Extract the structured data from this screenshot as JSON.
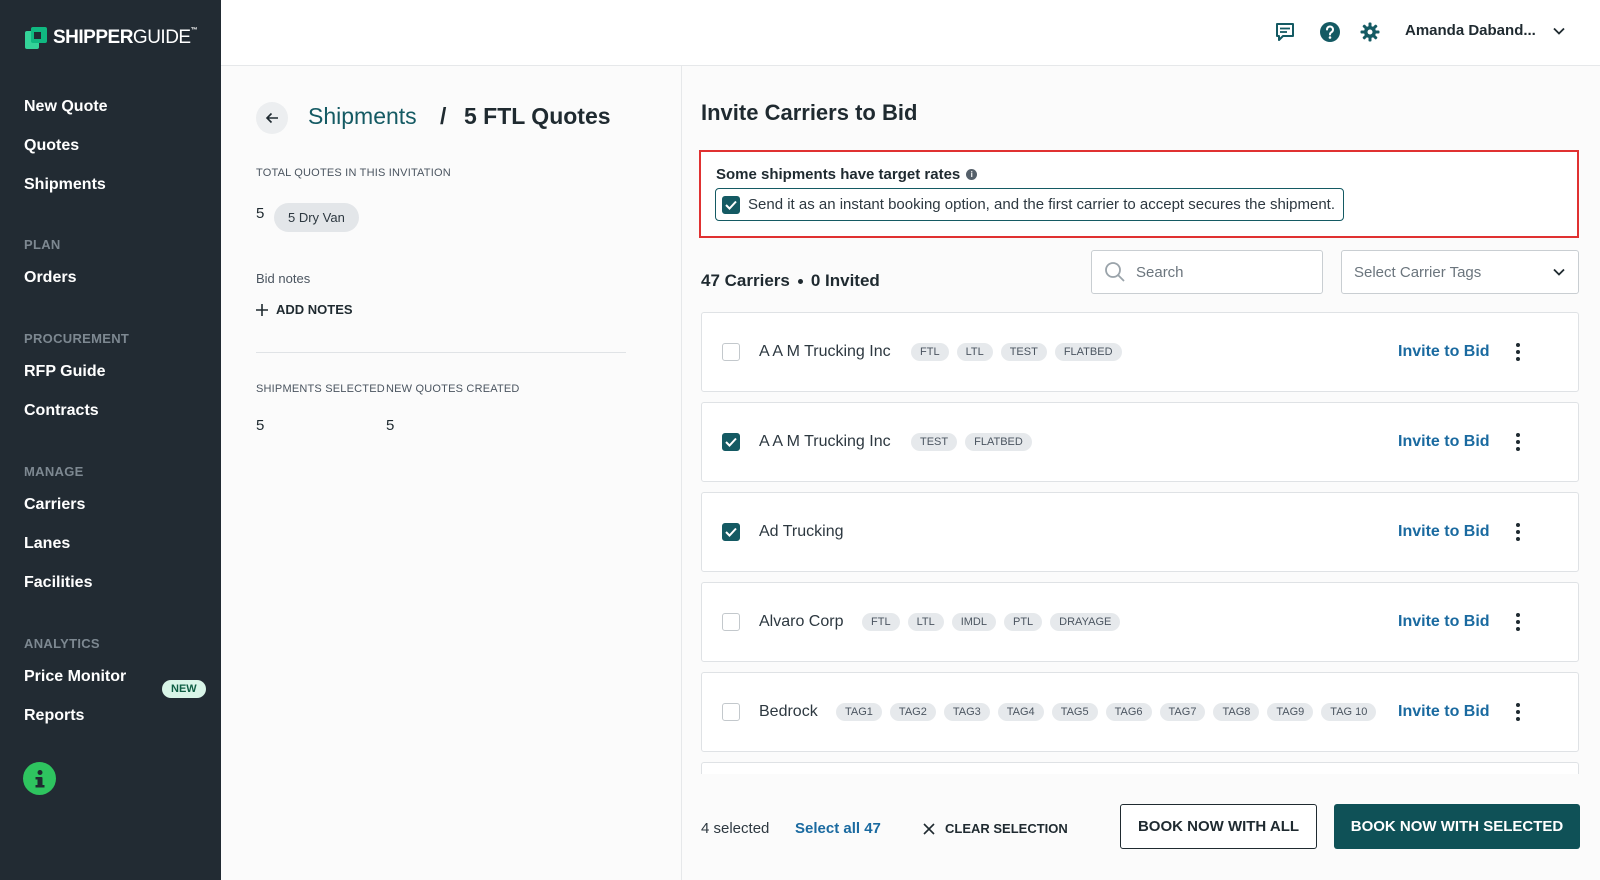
{
  "app": {
    "logo_bold": "SHIPPER",
    "logo_light": "GUIDE",
    "logo_tm": "™"
  },
  "sidebar": {
    "items_top": [
      {
        "label": "New Quote"
      },
      {
        "label": "Quotes"
      },
      {
        "label": "Shipments"
      }
    ],
    "section_plan": "PLAN",
    "orders": "Orders",
    "section_procurement": "PROCUREMENT",
    "rfp_guide": "RFP Guide",
    "contracts": "Contracts",
    "section_manage": "MANAGE",
    "carriers": "Carriers",
    "lanes": "Lanes",
    "facilities": "Facilities",
    "section_analytics": "ANALYTICS",
    "price_monitor": "Price Monitor",
    "new_badge": "NEW",
    "reports": "Reports",
    "info_icon": "info-icon"
  },
  "topbar": {
    "icons": [
      "chat-icon",
      "help-icon",
      "gear-icon"
    ],
    "user_name": "Amanda Daband..."
  },
  "left_panel": {
    "breadcrumb_link": "Shipments",
    "breadcrumb_sep": "/",
    "breadcrumb_current": "5 FTL Quotes",
    "total_label": "TOTAL QUOTES IN THIS INVITATION",
    "total_value": "5",
    "total_pill": "5 Dry Van",
    "bid_notes_label": "Bid notes",
    "add_notes": "ADD NOTES",
    "shipments_selected_label": "SHIPMENTS SELECTED",
    "shipments_selected_value": "5",
    "new_quotes_label": "NEW QUOTES CREATED",
    "new_quotes_value": "5"
  },
  "main": {
    "title": "Invite Carriers to Bid",
    "target_title": "Some shipments have target rates",
    "instant_booking_label": "Send it as an instant booking option, and the first carrier to accept secures the shipment.",
    "instant_booking_checked": true,
    "carrier_count": "47 Carriers",
    "invited_count": "0 Invited",
    "search_placeholder": "Search",
    "tags_placeholder": "Select Carrier Tags",
    "invite_label": "Invite to Bid",
    "carriers": [
      {
        "name": "A A M Trucking Inc",
        "checked": false,
        "tags": [
          "FTL",
          "LTL",
          "TEST",
          "FLATBED"
        ]
      },
      {
        "name": "A A M Trucking Inc",
        "checked": true,
        "tags": [
          "TEST",
          "FLATBED"
        ]
      },
      {
        "name": "Ad Trucking",
        "checked": true,
        "tags": []
      },
      {
        "name": "Alvaro Corp",
        "checked": false,
        "tags": [
          "FTL",
          "LTL",
          "IMDL",
          "PTL",
          "DRAYAGE"
        ]
      },
      {
        "name": "Bedrock",
        "checked": false,
        "tags": [
          "TAG1",
          "TAG2",
          "TAG3",
          "TAG4",
          "TAG5",
          "TAG6",
          "TAG7",
          "TAG8",
          "TAG9",
          "TAG 10"
        ]
      }
    ],
    "footer": {
      "selected": "4 selected",
      "select_all": "Select all 47",
      "clear": "CLEAR SELECTION",
      "book_all": "BOOK NOW WITH ALL",
      "book_selected": "BOOK NOW WITH SELECTED"
    }
  },
  "colors": {
    "sidebar_bg": "#222b33",
    "brand_teal": "#0f5157",
    "link_blue": "#1a6aa0",
    "alert_red": "#e03131"
  }
}
